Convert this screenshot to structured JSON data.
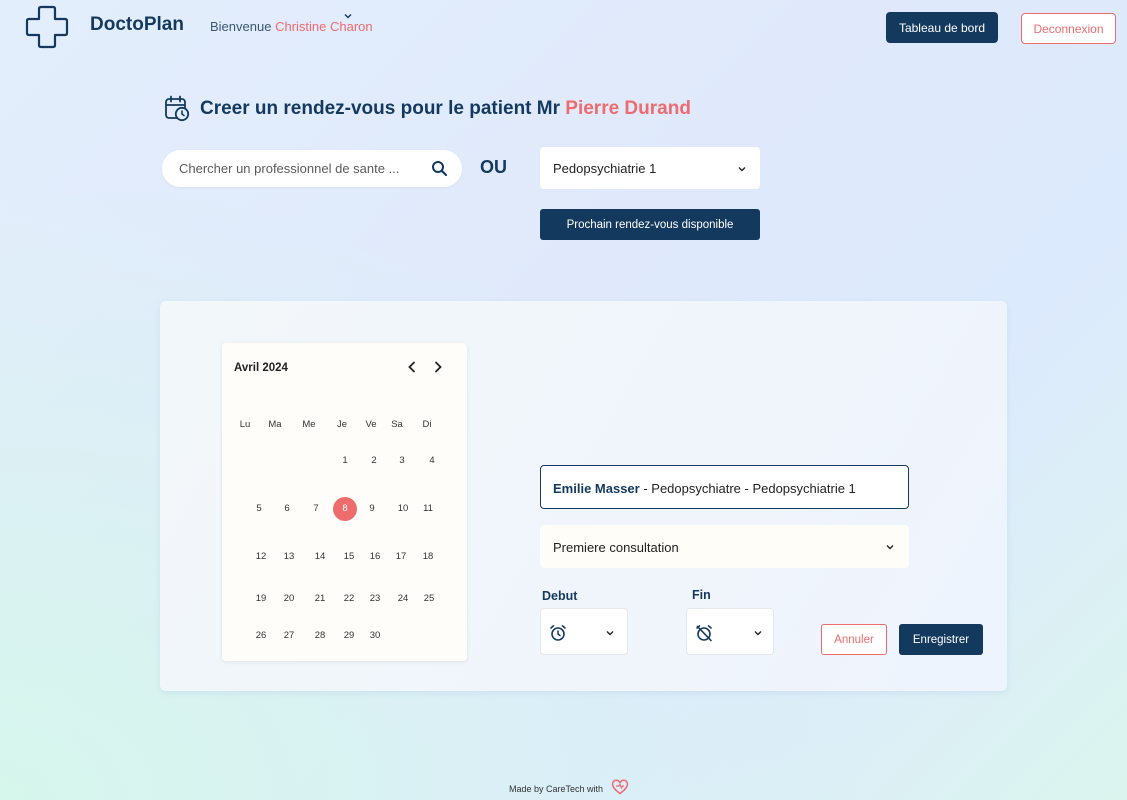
{
  "header": {
    "brand": "DoctoPlan",
    "welcome_prefix": "Bienvenue",
    "user_name": "Christine Charon",
    "dashboard_label": "Tableau de bord",
    "logout_label": "Deconnexion"
  },
  "page": {
    "title_prefix": "Creer un rendez-vous pour le patient Mr",
    "patient_name": "Pierre Durand"
  },
  "search": {
    "placeholder": "Chercher un professionnel de sante ...",
    "value": ""
  },
  "or_label": "OU",
  "specialty_select": {
    "selected": "Pedopsychiatrie 1"
  },
  "next_available_label": "Prochain rendez-vous disponible",
  "calendar": {
    "month_label": "Avril 2024",
    "weekdays": [
      "Lu",
      "Ma",
      "Me",
      "Je",
      "Ve",
      "Sa",
      "Di"
    ],
    "selected_day": 8,
    "days": [
      "1",
      "2",
      "3",
      "4",
      "5",
      "6",
      "7",
      "8",
      "9",
      "10",
      "11",
      "12",
      "13",
      "14",
      "15",
      "16",
      "17",
      "18",
      "19",
      "20",
      "21",
      "22",
      "23",
      "24",
      "25",
      "26",
      "27",
      "28",
      "29",
      "30"
    ]
  },
  "appointment": {
    "doctor_name": "Emilie Masser",
    "doctor_details": "- Pedopsychiatre - Pedopsychiatrie 1",
    "consultation_type": "Premiere consultation",
    "start_label": "Debut",
    "end_label": "Fin"
  },
  "actions": {
    "cancel_label": "Annuler",
    "save_label": "Enregistrer"
  },
  "footer": {
    "text": "Made by CareTech with"
  },
  "colors": {
    "primary": "#133a5e",
    "accent": "#ee6b6e"
  }
}
